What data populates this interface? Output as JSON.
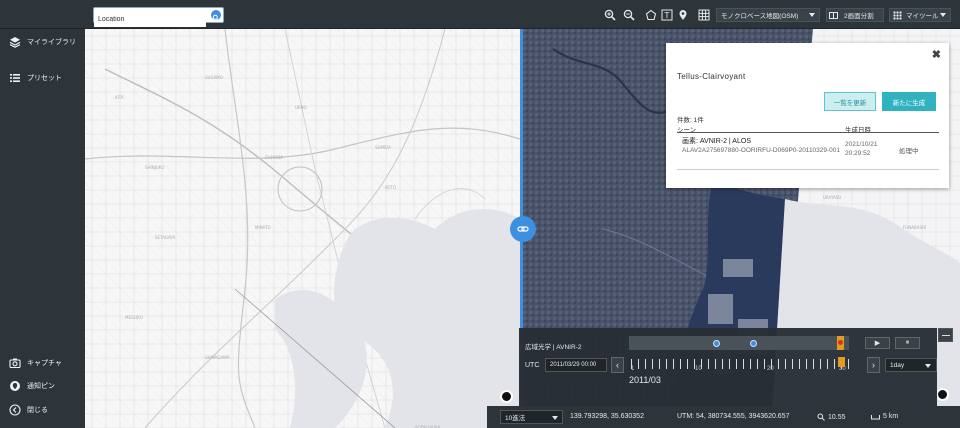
{
  "search": {
    "placeholder": "Location"
  },
  "toolbar": {
    "base_map_label": "モノクロベース地図(OSM)",
    "split_label": "2画面分割",
    "tools_label": "マイツール"
  },
  "sidebar": {
    "top_items": [
      {
        "label": "マイライブラリ",
        "icon": "layers-icon"
      },
      {
        "label": "プリセット",
        "icon": "list-icon"
      }
    ],
    "bottom_items": [
      {
        "label": "キャプチャ",
        "icon": "camera-icon"
      },
      {
        "label": "通知ピン",
        "icon": "pin-icon"
      },
      {
        "label": "閉じる",
        "icon": "back-arrow-icon"
      }
    ]
  },
  "popup": {
    "close_label": "✖",
    "title": "Tellus-Clairvoyant",
    "refresh_label": "一覧を更新",
    "create_label": "新たに生成",
    "count": "件数: 1件",
    "col_scene": "シーン",
    "col_date": "生成日時",
    "scene_name": "画素: AVNIR-2 | ALOS",
    "scene_id": "ALAV2A275697880-OORIRFU-D069P0-20110329-001",
    "date": "2021/10/21 20:29:52",
    "status": "処理中"
  },
  "timeline": {
    "source": "広域光学 | AVNIR-2",
    "play_label": "▶",
    "pause_label": "⏸",
    "utc_label": "UTC",
    "datetime": "2011/03/29 00:00",
    "prev_label": "‹",
    "next_label": "›",
    "tick_labels": [
      "1",
      "10",
      "20",
      "30"
    ],
    "month": "2011/03",
    "step": "1day"
  },
  "status": {
    "grid": "10進法",
    "coords": "139.793298, 35.630352",
    "utm": "UTM: 54, 380734.555, 3943620.657",
    "zoom": "10.55",
    "scale": "5 km"
  },
  "colors": {
    "accent": "#3d8fe0",
    "timeline_marker": "#e59b1f",
    "create_button": "#31b2c0"
  }
}
